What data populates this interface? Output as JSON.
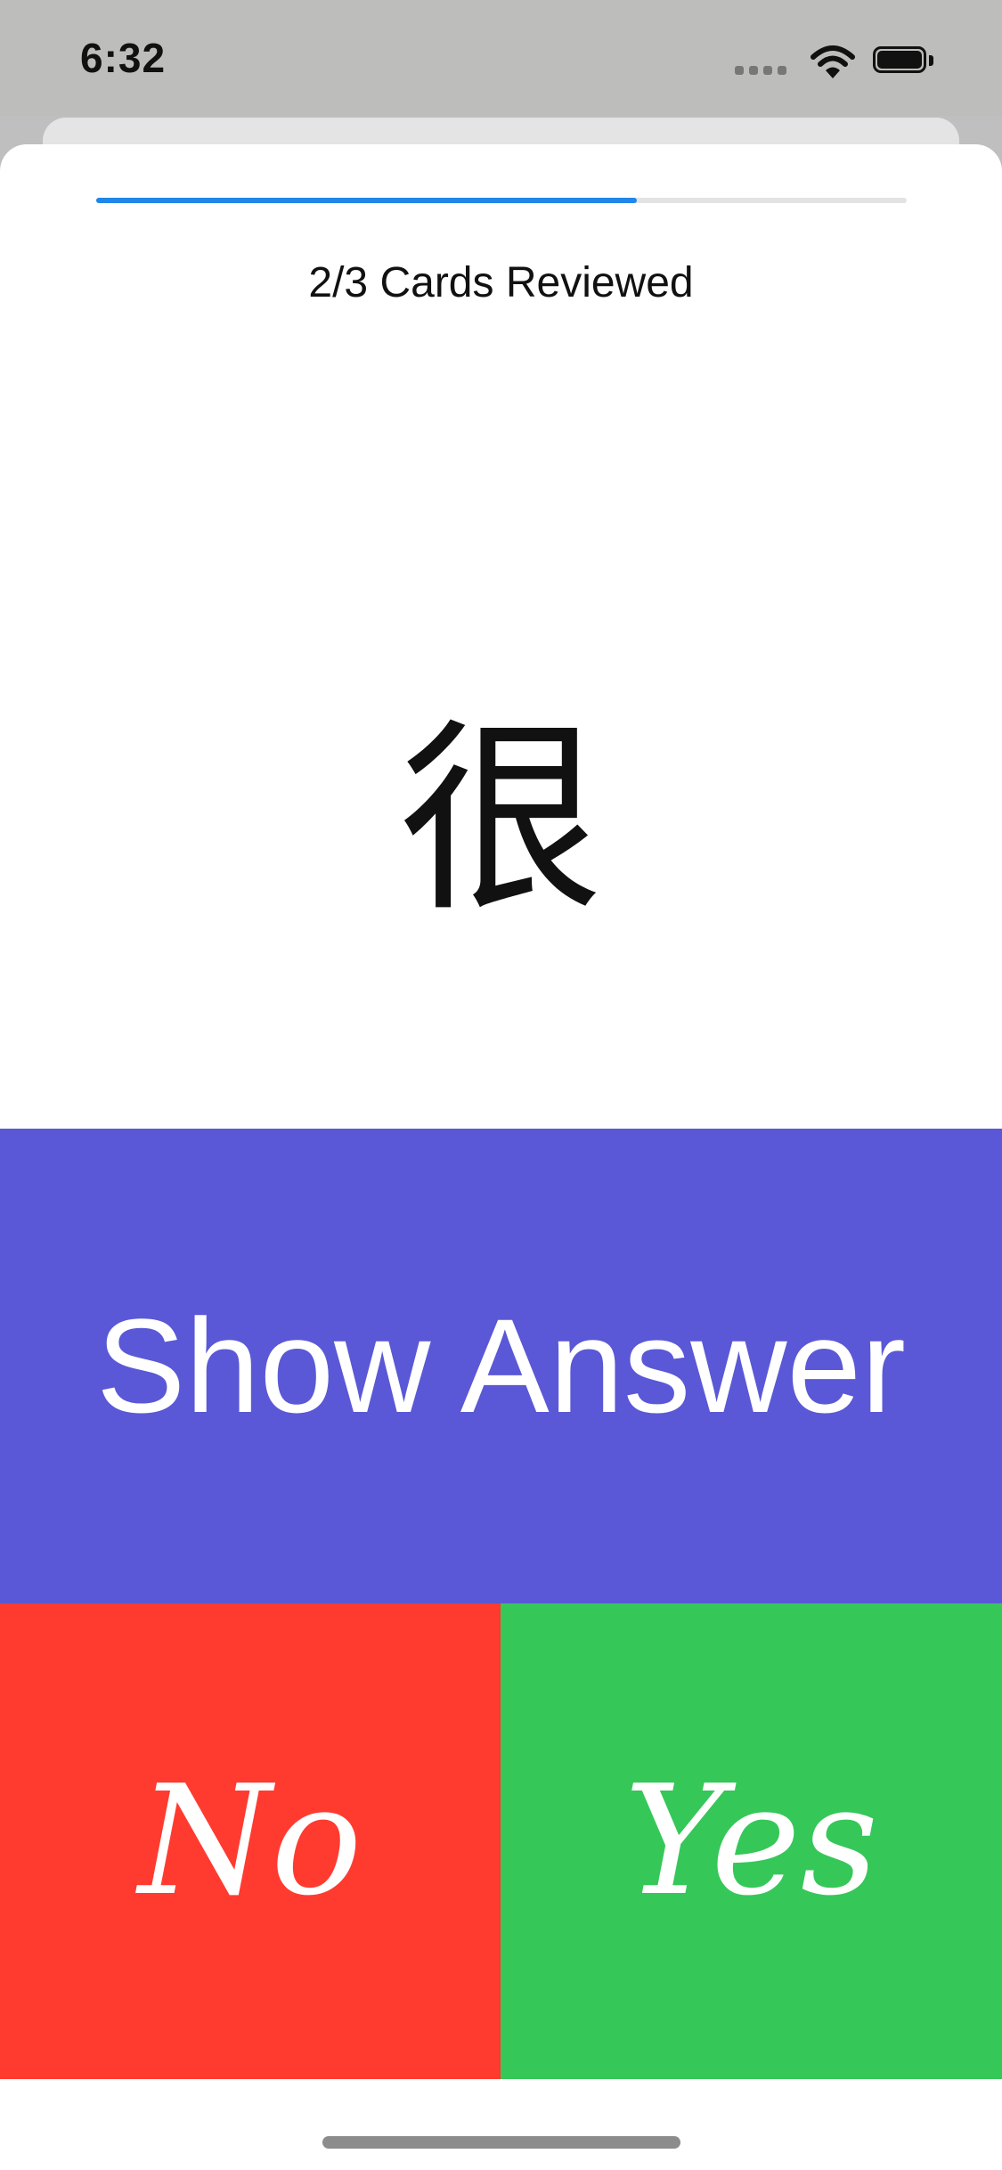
{
  "status_bar": {
    "time": "6:32",
    "icons": [
      "cellular-signal-icon",
      "wifi-icon",
      "battery-icon"
    ]
  },
  "review": {
    "progress_label": "2/3 Cards Reviewed",
    "progress_fraction": 0.667,
    "card_front": "很"
  },
  "actions": {
    "show_answer_label": "Show Answer",
    "no_label": "No",
    "yes_label": "Yes"
  },
  "colors": {
    "progress_fill": "#1f86ea",
    "show_answer_bg": "#5a58d6",
    "no_bg": "#ff3b30",
    "yes_bg": "#36c759"
  }
}
